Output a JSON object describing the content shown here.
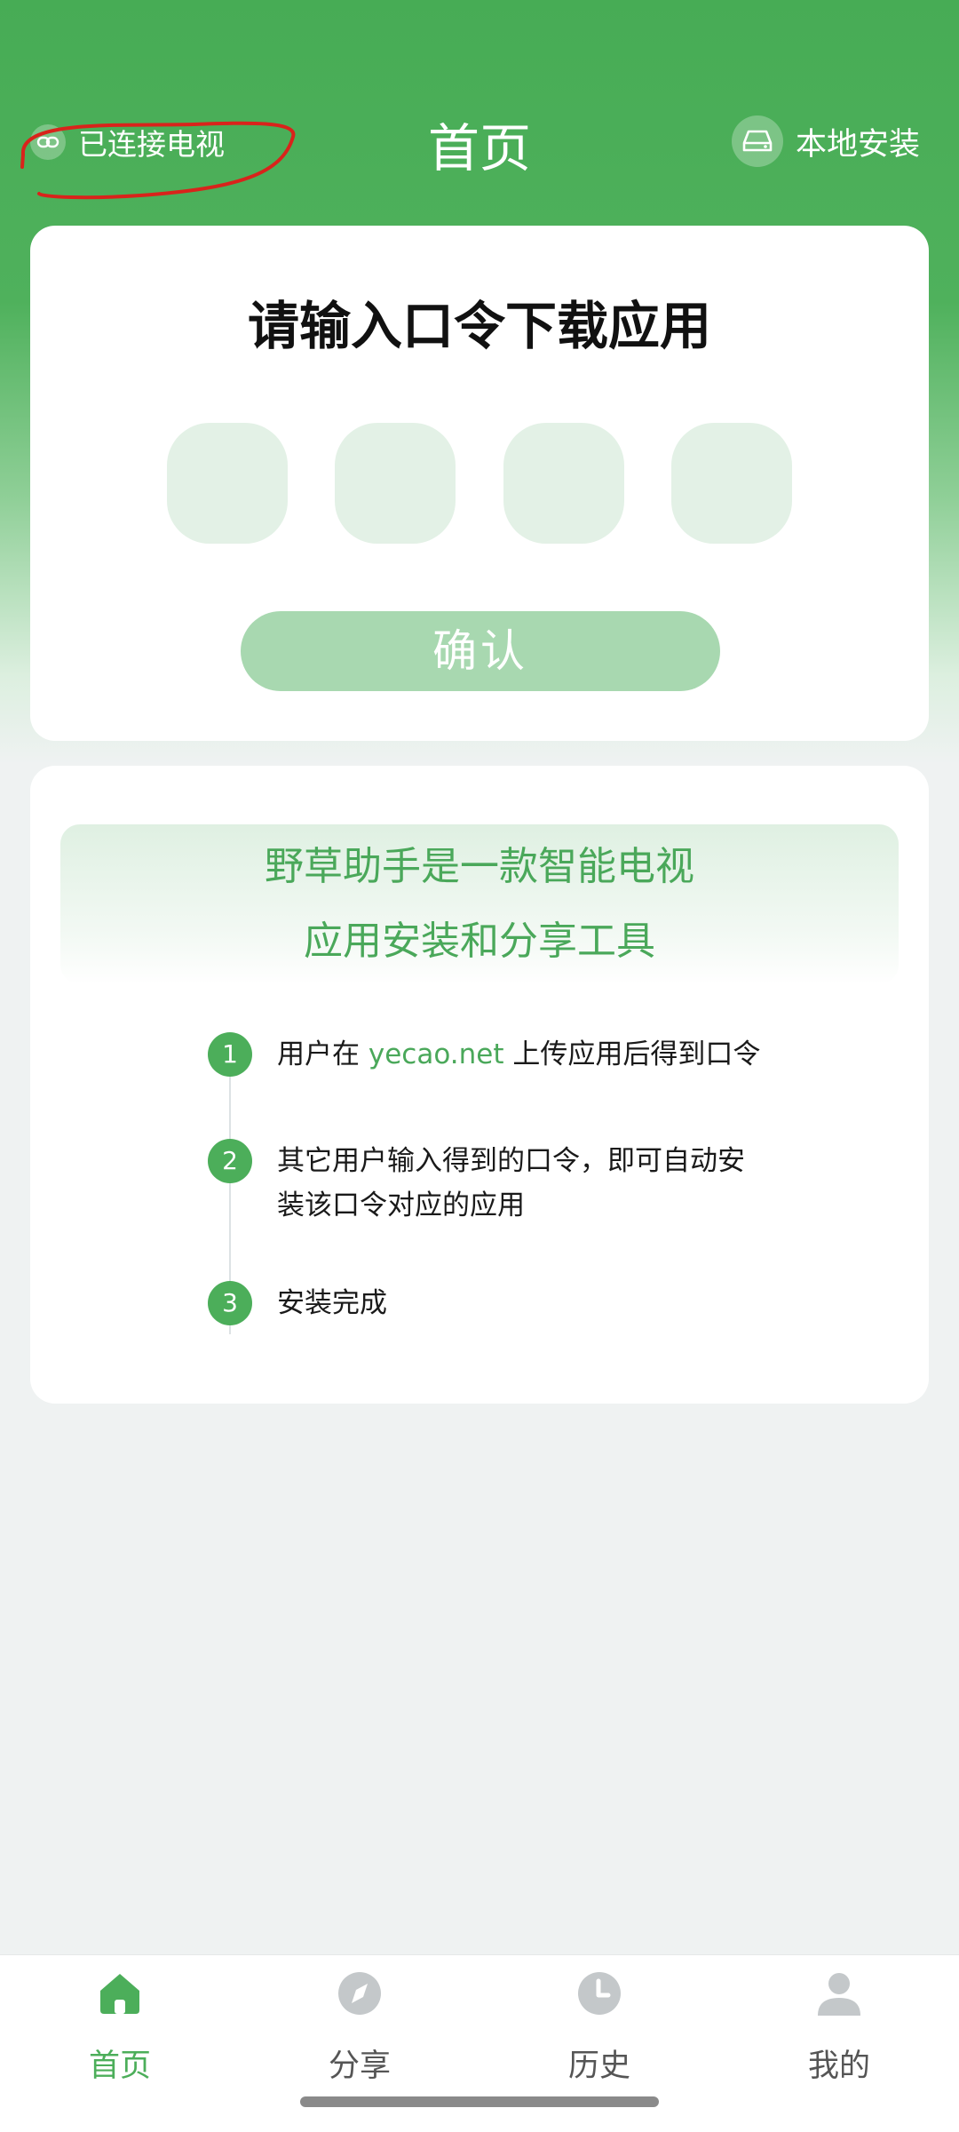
{
  "header": {
    "connect_label": "已连接电视",
    "title": "首页",
    "local_install_label": "本地安装"
  },
  "code_card": {
    "heading": "请输入口令下载应用",
    "code_boxes": [
      "",
      "",
      "",
      ""
    ],
    "confirm_label": "确认"
  },
  "info_card": {
    "intro_line1": "野草助手是一款智能电视",
    "intro_line2": "应用安装和分享工具",
    "steps": [
      {
        "num": "1",
        "pre": "用户在 ",
        "link": "yecao.net",
        "post": " 上传应用后得到口令"
      },
      {
        "num": "2",
        "text": "其它用户输入得到的口令，即可自动安装该口令对应的应用"
      },
      {
        "num": "3",
        "text": "安装完成"
      }
    ]
  },
  "tabbar": {
    "tabs": [
      {
        "label": "首页",
        "icon": "home-icon",
        "active": true
      },
      {
        "label": "分享",
        "icon": "compass-icon",
        "active": false
      },
      {
        "label": "历史",
        "icon": "clock-icon",
        "active": false
      },
      {
        "label": "我的",
        "icon": "user-icon",
        "active": false
      }
    ]
  },
  "colors": {
    "brand_green": "#47ac55",
    "accent_green": "#4cae5a",
    "button_disabled": "#a8d8b0",
    "code_box": "#e3f1e6",
    "annotation_red": "#d9231b"
  }
}
